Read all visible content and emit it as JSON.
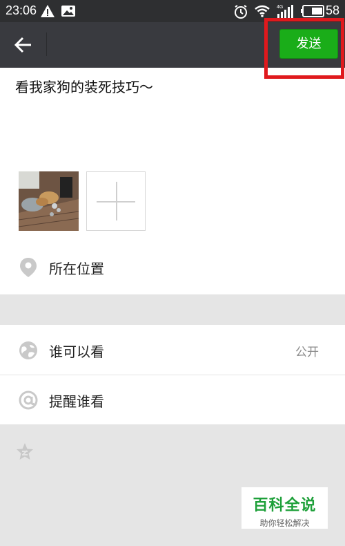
{
  "status_bar": {
    "time": "23:06",
    "network": "4G",
    "battery": "58",
    "icons": [
      "warning-icon",
      "image-notification-icon",
      "alarm-icon",
      "wifi-icon",
      "signal-icon",
      "battery-icon"
    ]
  },
  "action_bar": {
    "back_icon": "arrow-left-icon",
    "send_label": "发送",
    "send_color": "#1aad19",
    "highlight_color": "#e0191d"
  },
  "post": {
    "text": "看我家狗的装死技巧～",
    "add_photo_icon": "plus-icon"
  },
  "location": {
    "label": "所在位置",
    "icon": "location-pin-icon"
  },
  "settings": {
    "visibility": {
      "label": "谁可以看",
      "value": "公开",
      "icon": "globe-icon"
    },
    "mention": {
      "label": "提醒谁看",
      "icon": "at-sign-icon"
    }
  },
  "extra": {
    "star_icon": "star-icon"
  },
  "watermark": {
    "title": "百科全说",
    "subtitle": "助你轻松解决"
  }
}
